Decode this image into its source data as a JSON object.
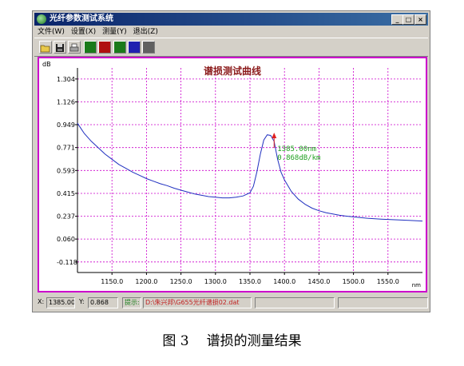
{
  "window": {
    "title": "光纤参数测试系统",
    "controls": {
      "minimize": "_",
      "maximize": "□",
      "close": "×"
    }
  },
  "menu": [
    {
      "label": "文件(W)"
    },
    {
      "label": "设置(X)"
    },
    {
      "label": "测量(Y)"
    },
    {
      "label": "退出(Z)"
    }
  ],
  "toolbar": [
    {
      "icon": "open-folder-icon"
    },
    {
      "icon": "save-disk-icon"
    },
    {
      "icon": "printer-icon"
    },
    {
      "icon": "measure-mode-1-icon",
      "color": "#1a7a1a"
    },
    {
      "icon": "measure-mode-2-icon",
      "color": "#b01010"
    },
    {
      "icon": "measure-mode-3-icon",
      "color": "#1a7a1a"
    },
    {
      "icon": "measure-mode-4-icon",
      "color": "#2020b0"
    },
    {
      "icon": "measure-mode-5-icon",
      "color": "#606060"
    }
  ],
  "chart_data": {
    "type": "line",
    "title": "谱损测试曲线",
    "ylabel": "dB",
    "xunit": "nm",
    "xlim": [
      1100,
      1600
    ],
    "ylim": [
      -0.2,
      1.39
    ],
    "xticks": [
      1150,
      1200,
      1250,
      1300,
      1350,
      1400,
      1450,
      1500,
      1550
    ],
    "xtick_labels": [
      "1150.0",
      "1200.0",
      "1250.0",
      "1300.0",
      "1350.0",
      "1400.0",
      "1450.0",
      "1500.0",
      "1550.0"
    ],
    "yticks": [
      1.304,
      1.126,
      0.949,
      0.771,
      0.593,
      0.415,
      0.237,
      0.06,
      -0.118
    ],
    "ytick_labels": [
      "1.304",
      "1.126",
      "0.949",
      "0.771",
      "0.593",
      "0.415",
      "0.237",
      "0.060",
      "-0.118"
    ],
    "grid": true,
    "series": [
      {
        "color": "#2030c0",
        "x": [
          1100,
          1105,
          1110,
          1120,
          1130,
          1140,
          1150,
          1160,
          1170,
          1180,
          1190,
          1200,
          1210,
          1220,
          1230,
          1240,
          1250,
          1260,
          1270,
          1280,
          1290,
          1300,
          1310,
          1320,
          1330,
          1340,
          1350,
          1355,
          1360,
          1365,
          1370,
          1375,
          1380,
          1385,
          1390,
          1395,
          1400,
          1410,
          1420,
          1430,
          1440,
          1450,
          1460,
          1470,
          1480,
          1490,
          1500,
          1520,
          1540,
          1560,
          1580,
          1600
        ],
        "y": [
          0.96,
          0.92,
          0.88,
          0.82,
          0.77,
          0.72,
          0.68,
          0.64,
          0.61,
          0.58,
          0.555,
          0.53,
          0.51,
          0.49,
          0.475,
          0.455,
          0.44,
          0.425,
          0.41,
          0.4,
          0.39,
          0.385,
          0.38,
          0.38,
          0.385,
          0.395,
          0.42,
          0.47,
          0.58,
          0.72,
          0.83,
          0.87,
          0.865,
          0.82,
          0.68,
          0.58,
          0.52,
          0.43,
          0.37,
          0.33,
          0.3,
          0.28,
          0.265,
          0.255,
          0.245,
          0.238,
          0.232,
          0.222,
          0.215,
          0.21,
          0.205,
          0.2
        ]
      }
    ],
    "marker": {
      "x": 1385.0,
      "y": 0.868,
      "color": "#e02020"
    },
    "annotation": {
      "lines": [
        "1385.00nm",
        "0.868dB/km"
      ],
      "color": "#20a020"
    }
  },
  "status": {
    "x_label": "X:",
    "x_value": "1385.00",
    "y_label": "Y:",
    "y_value": "0.868",
    "hint_label": "提示:",
    "hint_text": "D:\\朱兴邦\\G655光纤谱损02.dat"
  },
  "caption": {
    "number": "图 3",
    "text": "谱损的测量结果"
  }
}
